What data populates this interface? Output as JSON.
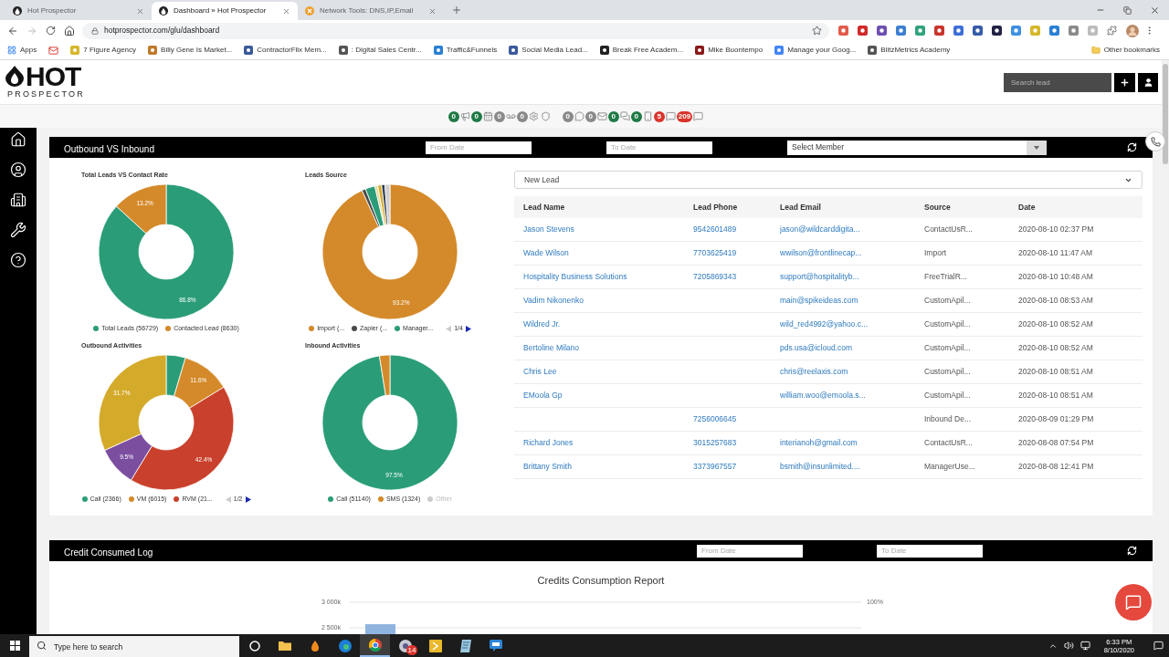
{
  "browser": {
    "tabs": [
      {
        "title": "Hot Prospector",
        "selected": false
      },
      {
        "title": "Dashboard » Hot Prospector",
        "selected": true
      },
      {
        "title": "Network Tools: DNS,IP,Email",
        "selected": false
      }
    ],
    "address": "hotprospector.com/glu/dashboard",
    "bookmarks": [
      {
        "kind": "apps",
        "label": "Apps"
      },
      {
        "kind": "mail"
      },
      {
        "kind": "site",
        "label": "7 Figure Agency"
      },
      {
        "kind": "site",
        "label": "Billy Gene Is Market..."
      },
      {
        "kind": "site",
        "label": "ContractorFlix Mem..."
      },
      {
        "kind": "site",
        "label": ": Digital Sales Centr..."
      },
      {
        "kind": "site",
        "label": "Traffic&Funnels"
      },
      {
        "kind": "site",
        "label": "Social Media Lead..."
      },
      {
        "kind": "site",
        "label": "Break Free Academ..."
      },
      {
        "kind": "site",
        "label": "Mike Buontempo"
      },
      {
        "kind": "site",
        "label": "Manage your Goog..."
      },
      {
        "kind": "site",
        "label": "BlitzMetrics Academy"
      }
    ],
    "other_bookmarks": "Other bookmarks"
  },
  "header": {
    "logo": {
      "word": "HOT",
      "tagline": "PROSPECTOR"
    },
    "search": {
      "placeholder": "Search lead"
    }
  },
  "activity_counters": [
    {
      "kind": "badge",
      "count": "0",
      "color": "#1f7a46"
    },
    {
      "kind": "badge",
      "count": "0",
      "color": "#1f7a46"
    },
    {
      "kind": "badge",
      "count": "0",
      "color": "#8a8a8a"
    },
    {
      "kind": "badge",
      "count": "0",
      "color": "#8a8a8a"
    },
    {
      "kind": "plain"
    },
    {
      "kind": "badge",
      "count": "0",
      "color": "#8a8a8a"
    },
    {
      "kind": "badge",
      "count": "0",
      "color": "#8a8a8a"
    },
    {
      "kind": "badge",
      "count": "0",
      "color": "#1f7a46"
    },
    {
      "kind": "badge",
      "count": "0",
      "color": "#1f7a46"
    },
    {
      "kind": "badge",
      "count": "5",
      "color": "#d9342b"
    },
    {
      "kind": "badge",
      "count": "209",
      "color": "#d9342b"
    }
  ],
  "overview_panel": {
    "title": "Outbound VS Inbound",
    "from_date": {
      "placeholder": "From Date"
    },
    "to_date": {
      "placeholder": "To Date"
    },
    "member_select": {
      "placeholder": "Select Member"
    },
    "charts": [
      {
        "chart_data": {
          "type": "donut",
          "title": "Total Leads VS Contact Rate",
          "categories": [
            "Total Leads (56729)",
            "Contacted Lead (8630)"
          ],
          "values": [
            86.8,
            13.2
          ],
          "colors": [
            "#2a9d78",
            "#d48a2a"
          ],
          "value_labels": [
            "86.8%",
            "13.2%"
          ]
        }
      },
      {
        "chart_data": {
          "type": "donut",
          "title": "Leads Source",
          "categories": [
            "Import (...",
            "Zapier (...",
            "Manager...",
            null,
            null,
            null,
            null
          ],
          "values": [
            93.2,
            0.9,
            2.3,
            0.7,
            0.9,
            0.8,
            1.2
          ],
          "colors": [
            "#d48a2a",
            "#4a4a4a",
            "#2a9d78",
            "#e6d9a0",
            "#d6ae2c",
            "#2f3b55",
            "#cfcfcf"
          ],
          "value_labels": [
            "93.2%",
            null,
            null,
            null,
            null,
            null,
            null
          ]
        },
        "legend_pager": {
          "page": "1/4",
          "prev_enabled": false,
          "next_enabled": true
        }
      },
      {
        "chart_data": {
          "type": "donut",
          "title": "Outbound Activities",
          "categories": [
            "Call (2366)",
            "VM (6015)",
            "RVM (21...",
            null,
            null
          ],
          "values": [
            4.6,
            11.6,
            42.4,
            9.5,
            31.7
          ],
          "colors": [
            "#2a9d78",
            "#d48a2a",
            "#c9402c",
            "#7b4ea0",
            "#d4aa2a"
          ],
          "value_labels": [
            null,
            "11.6%",
            "42.4%",
            "9.5%",
            "31.7%"
          ]
        },
        "legend_pager": {
          "page": "1/2",
          "prev_enabled": false,
          "next_enabled": true
        }
      },
      {
        "chart_data": {
          "type": "donut",
          "title": "Inbound Activities",
          "categories": [
            "Call (51140)",
            "SMS (1324)",
            "Other"
          ],
          "values": [
            97.5,
            2.5,
            null
          ],
          "colors": [
            "#2a9d78",
            "#d48a2a",
            "#cccccc"
          ],
          "value_labels": [
            "97.5%",
            null,
            null
          ]
        }
      }
    ],
    "lead_filter": {
      "value": "New Lead"
    },
    "table": {
      "columns": [
        "Lead Name",
        "Lead Phone",
        "Lead Email",
        "Source",
        "Date"
      ],
      "rows": [
        {
          "name": "Jason Stevens",
          "phone": "9542601489",
          "email": "jason@wildcarddigita...",
          "source": "ContactUsR...",
          "date": "2020-08-10 02:37 PM"
        },
        {
          "name": "Wade Wilson",
          "phone": "7703625419",
          "email": "wwilson@frontlinecap...",
          "source": "Import",
          "date": "2020-08-10 11:47 AM"
        },
        {
          "name": "Hospitality Business Solutions",
          "phone": "7205869343",
          "email": "support@hospitalityb...",
          "source": "FreeTrialR...",
          "date": "2020-08-10 10:48 AM"
        },
        {
          "name": "Vadim Nikonenko",
          "email": "main@spikeideas.com",
          "source": "CustomApil...",
          "date": "2020-08-10 08:53 AM"
        },
        {
          "name": "Wildred Jr.",
          "email": "wild_red4992@yahoo.c...",
          "source": "CustomApil...",
          "date": "2020-08-10 08:52 AM"
        },
        {
          "name": "Bertoline Milano",
          "email": "pds.usa@icloud.com",
          "source": "CustomApil...",
          "date": "2020-08-10 08:52 AM"
        },
        {
          "name": "Chris Lee",
          "email": "chris@reelaxis.com",
          "source": "CustomApil...",
          "date": "2020-08-10 08:51 AM"
        },
        {
          "name": "EMoola Gp",
          "email": "william.woo@emoola.s...",
          "source": "CustomApil...",
          "date": "2020-08-10 08:51 AM"
        },
        {
          "phone": "7256006645",
          "source": "Inbound De...",
          "date": "2020-08-09 01:29 PM"
        },
        {
          "name": "Richard Jones",
          "phone": "3015257683",
          "email": "interianoh@gmail.com",
          "source": "ContactUsR...",
          "date": "2020-08-08 07:54 PM"
        },
        {
          "name": "Brittany Smith",
          "phone": "3373967557",
          "email": "bsmith@insunlimited....",
          "source": "ManagerUse...",
          "date": "2020-08-08 12:41 PM"
        }
      ]
    }
  },
  "credit_panel": {
    "title": "Credit Consumed Log",
    "from_date": {
      "placeholder": "From Date"
    },
    "to_date": {
      "placeholder": "To Date"
    },
    "chart_data": {
      "type": "bar",
      "title": "Credits Consumption Report",
      "categories": [
        null
      ],
      "values": [
        2570
      ],
      "color": "#8fb4e0",
      "ylim": [
        2375,
        3000
      ],
      "yticks": [
        {
          "value": 2500,
          "label": "2 500k"
        },
        {
          "value": 3000,
          "label": "3 000k"
        }
      ],
      "annotations": [
        "100%"
      ],
      "grid": true
    }
  },
  "taskbar": {
    "search": {
      "placeholder": "Type here to search"
    },
    "apps": [
      {
        "selected": false
      },
      {
        "selected": false
      },
      {
        "selected": false
      },
      {
        "selected": false
      },
      {
        "selected": true
      },
      {
        "selected": false,
        "badge": "14"
      },
      {
        "selected": false
      },
      {
        "selected": false
      },
      {
        "selected": false
      }
    ],
    "time": "6:33 PM",
    "date": "8/10/2020"
  }
}
